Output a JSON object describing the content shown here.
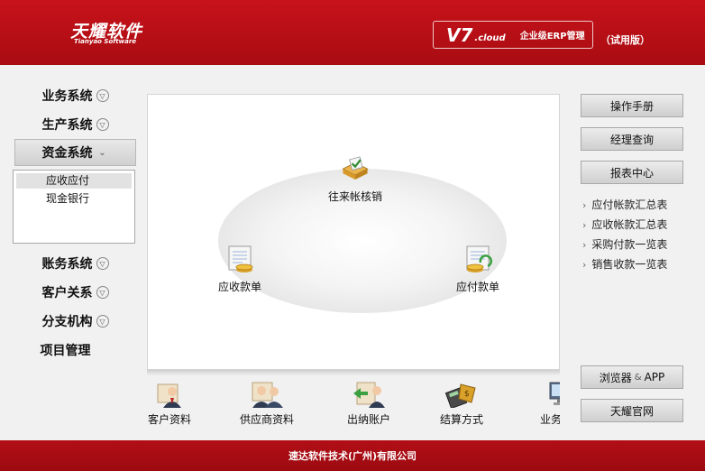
{
  "header": {
    "logo_cn": "天耀软件",
    "logo_en": "Tianyao Software",
    "version": "V7",
    "version_suffix": ".cloud",
    "product": "企业级ERP管理",
    "edition": "（试用版）"
  },
  "nav": {
    "items": [
      {
        "label": "业务系统"
      },
      {
        "label": "生产系统"
      },
      {
        "label": "资金系统"
      },
      {
        "label": "账务系统"
      },
      {
        "label": "客户关系"
      },
      {
        "label": "分支机构"
      },
      {
        "label": "项目管理"
      }
    ],
    "submenu": [
      {
        "label": "应收应付",
        "selected": true
      },
      {
        "label": "现金银行",
        "selected": false
      }
    ]
  },
  "flow": {
    "top": "往来帐核销",
    "left": "应收款单",
    "right": "应付款单"
  },
  "bottom_icons": [
    {
      "label": "客户资料"
    },
    {
      "label": "供应商资料"
    },
    {
      "label": "出纳账户"
    },
    {
      "label": "结算方式"
    },
    {
      "label": "业务套"
    }
  ],
  "right_panel": {
    "manual": "操作手册",
    "manager_query": "经理查询",
    "report_center": "报表中心",
    "report_links": [
      "应付帐款汇总表",
      "应收帐款汇总表",
      "采购付款一览表",
      "销售收款一览表"
    ],
    "browser_app_a": "浏览器",
    "browser_app_amp": "&",
    "browser_app_b": "APP",
    "official_site": "天耀官网"
  },
  "footer": {
    "company": "速达软件技术(广州)有限公司"
  },
  "colors": {
    "brand_red": "#b20f16",
    "panel_bg": "#f1f1f1"
  }
}
